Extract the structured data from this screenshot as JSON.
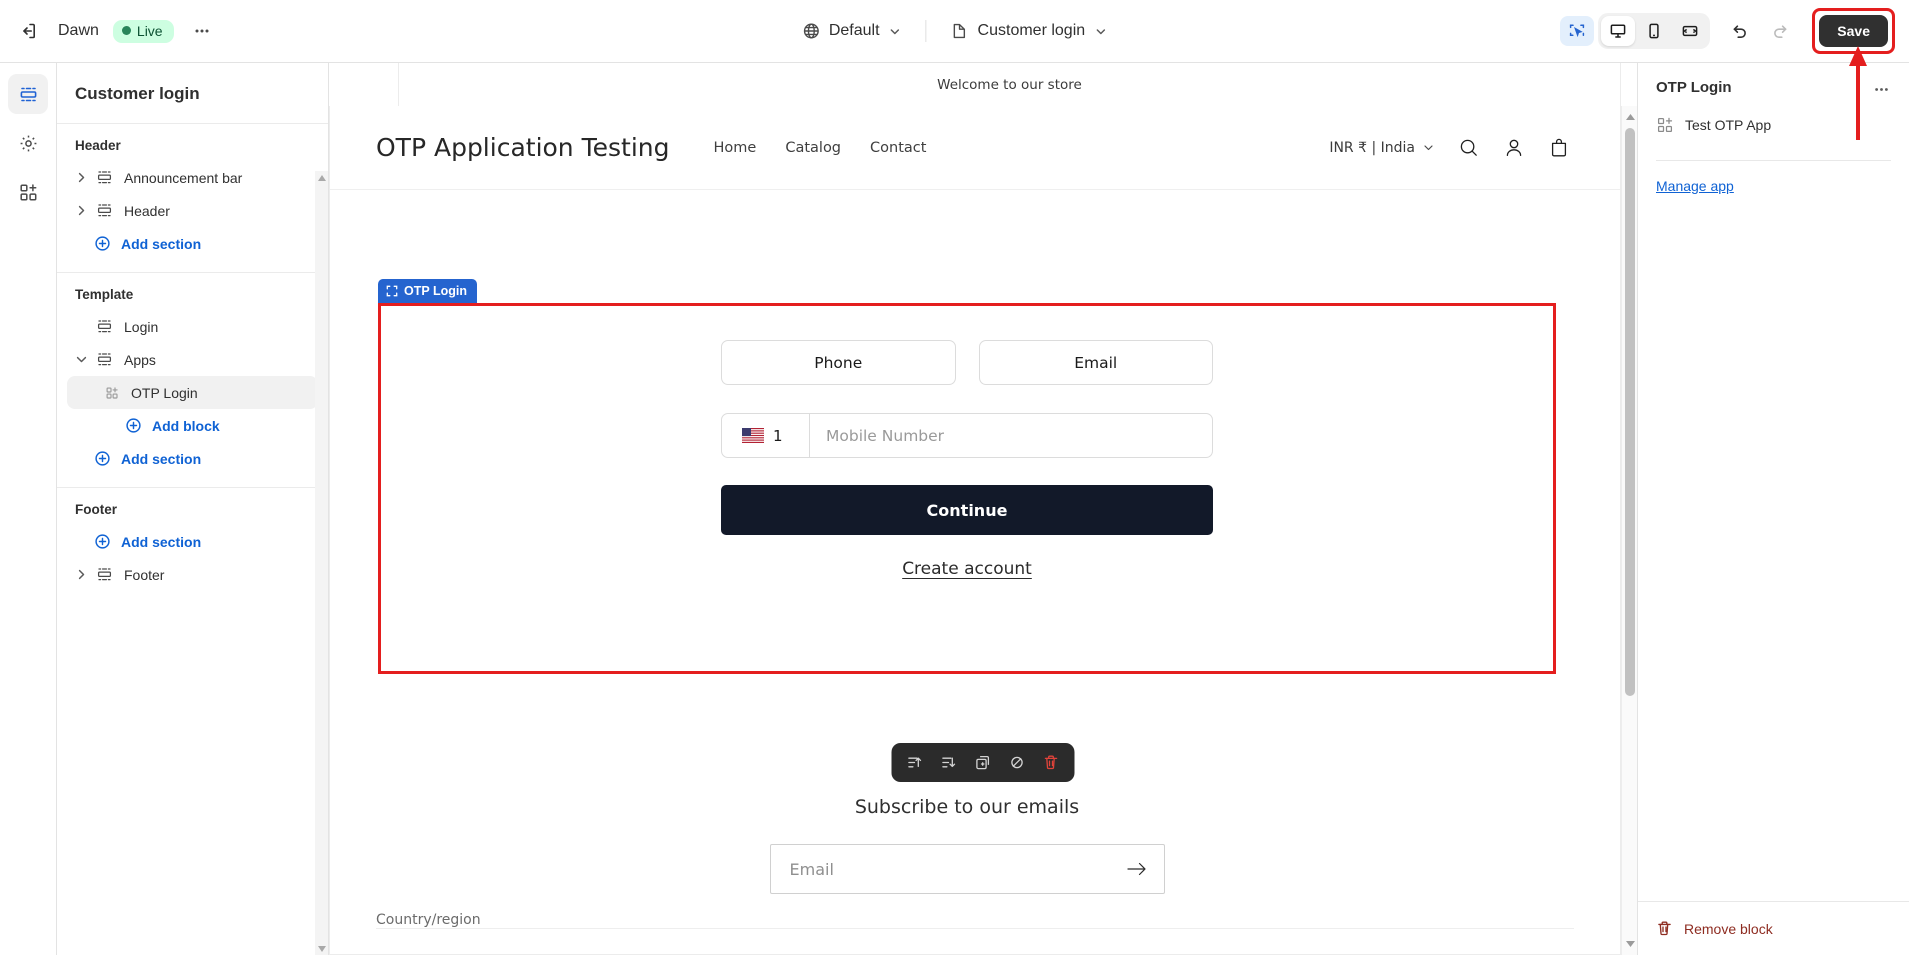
{
  "topbar": {
    "exit_label": "Exit",
    "theme_name": "Dawn",
    "status_badge": "Live",
    "more_label": "More actions",
    "locale_selector": "Default",
    "page_selector": "Customer login",
    "inspect_label": "Inspect",
    "desktop_label": "Desktop",
    "mobile_label": "Mobile",
    "fullscreen_label": "Full screen",
    "undo_label": "Undo",
    "redo_label": "Redo",
    "save_label": "Save",
    "accent_blue": "#0f62d4",
    "save_bg": "#303030",
    "annotation_red": "#e41e1e",
    "live_bg": "#cdfee1",
    "live_text": "#0c5132"
  },
  "rail": {
    "items": [
      {
        "name": "sections",
        "label": "Sections"
      },
      {
        "name": "settings",
        "label": "Theme settings"
      },
      {
        "name": "apps",
        "label": "Apps"
      }
    ]
  },
  "sections_panel": {
    "title": "Customer login",
    "groups": [
      {
        "label": "Header",
        "rows": [
          {
            "label": "Announcement bar",
            "type": "section",
            "expandable": true,
            "selected": false
          },
          {
            "label": "Header",
            "type": "section",
            "expandable": true,
            "selected": false
          },
          {
            "label": "Add section",
            "type": "add",
            "expandable": false,
            "selected": false
          }
        ]
      },
      {
        "label": "Template",
        "rows": [
          {
            "label": "Login",
            "type": "section",
            "expandable": false,
            "selected": false
          },
          {
            "label": "Apps",
            "type": "section",
            "expandable": true,
            "expanded": true,
            "selected": false
          },
          {
            "label": "OTP Login",
            "type": "block",
            "expandable": false,
            "selected": true
          },
          {
            "label": "Add block",
            "type": "addblock",
            "expandable": false,
            "selected": false
          },
          {
            "label": "Add section",
            "type": "add",
            "expandable": false,
            "selected": false
          }
        ]
      },
      {
        "label": "Footer",
        "rows": [
          {
            "label": "Add section",
            "type": "add",
            "expandable": false,
            "selected": false
          },
          {
            "label": "Footer",
            "type": "section",
            "expandable": true,
            "selected": false
          }
        ]
      }
    ]
  },
  "preview": {
    "announcement": "Welcome to our store",
    "store_name": "OTP Application Testing",
    "nav": [
      "Home",
      "Catalog",
      "Contact"
    ],
    "currency": "INR ₹ | India",
    "header_icons": [
      "search-icon",
      "account-icon",
      "cart-icon"
    ],
    "selected_block_tag": "OTP Login",
    "otp_form": {
      "tab_phone": "Phone",
      "tab_email": "Email",
      "country_code": "1",
      "country_flag": "us-flag",
      "mobile_placeholder": "Mobile Number",
      "continue_label": "Continue",
      "create_account_label": "Create account",
      "continue_bg": "#121929"
    },
    "block_toolbar": [
      {
        "name": "move-up-icon",
        "label": "Move up"
      },
      {
        "name": "move-down-icon",
        "label": "Move down"
      },
      {
        "name": "duplicate-icon",
        "label": "Duplicate"
      },
      {
        "name": "hide-icon",
        "label": "Hide"
      },
      {
        "name": "delete-icon",
        "label": "Delete"
      }
    ],
    "newsletter": {
      "title": "Subscribe to our emails",
      "placeholder": "Email",
      "submit_label": "Subscribe"
    },
    "country_region_label": "Country/region"
  },
  "right_panel": {
    "title": "OTP Login",
    "app_name": "Test OTP App",
    "manage_link": "Manage app",
    "remove_label": "Remove block",
    "more_label": "More options",
    "remove_color": "#8e2c21"
  }
}
